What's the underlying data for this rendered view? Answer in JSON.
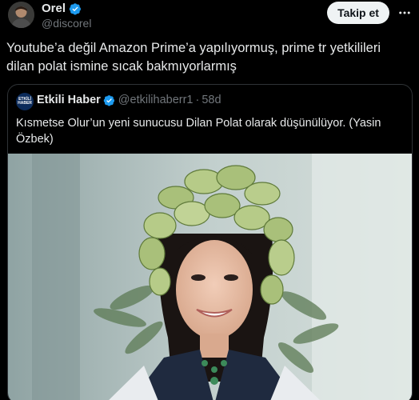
{
  "author": {
    "name": "Orel",
    "handle": "@discorel",
    "verified": true
  },
  "follow_button": {
    "label": "Takip et"
  },
  "tweet": {
    "text": "Youtube’a değil Amazon Prime’a yapılıyormuş, prime tr yetkilileri dilan polat ismine sıcak bakmıyorlarmış"
  },
  "quoted_tweet": {
    "author_name": "Etkili Haber",
    "avatar_text": "ETKİLİ HABER",
    "handle": "@etkilihaberr1",
    "separator": "·",
    "time": "58d",
    "text": "Kısmetse Olur’un yeni sunucusu Dilan Polat olarak düşünülüyor. (Yasin Özbek)"
  },
  "icons": {
    "verified": "verified-badge-icon",
    "more": "more-options-icon"
  },
  "colors": {
    "background": "#000000",
    "text_primary": "#e7e9ea",
    "text_secondary": "#71767b",
    "verified_blue": "#1d9bf0",
    "border": "#2f3336",
    "follow_button_bg": "#eff3f4"
  }
}
